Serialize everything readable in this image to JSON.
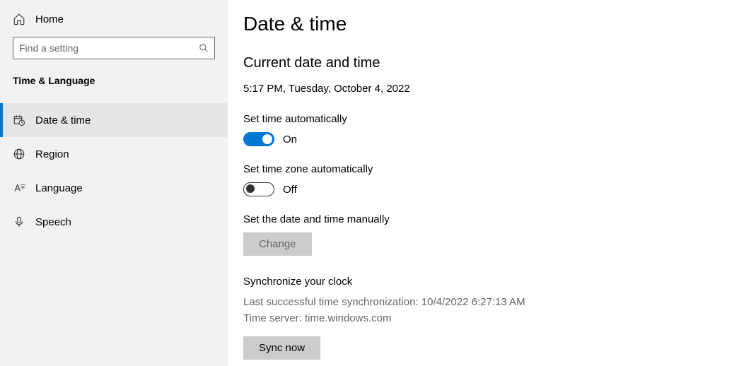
{
  "sidebar": {
    "home_label": "Home",
    "search_placeholder": "Find a setting",
    "category": "Time & Language",
    "items": [
      {
        "label": "Date & time"
      },
      {
        "label": "Region"
      },
      {
        "label": "Language"
      },
      {
        "label": "Speech"
      }
    ]
  },
  "main": {
    "title": "Date & time",
    "current_heading": "Current date and time",
    "current_value": "5:17 PM, Tuesday, October 4, 2022",
    "set_time_auto_label": "Set time automatically",
    "set_time_auto_state": "On",
    "set_tz_auto_label": "Set time zone automatically",
    "set_tz_auto_state": "Off",
    "manual_label": "Set the date and time manually",
    "change_button": "Change",
    "sync_heading": "Synchronize your clock",
    "sync_last": "Last successful time synchronization: 10/4/2022 6:27:13 AM",
    "sync_server": "Time server: time.windows.com",
    "sync_button": "Sync now"
  }
}
